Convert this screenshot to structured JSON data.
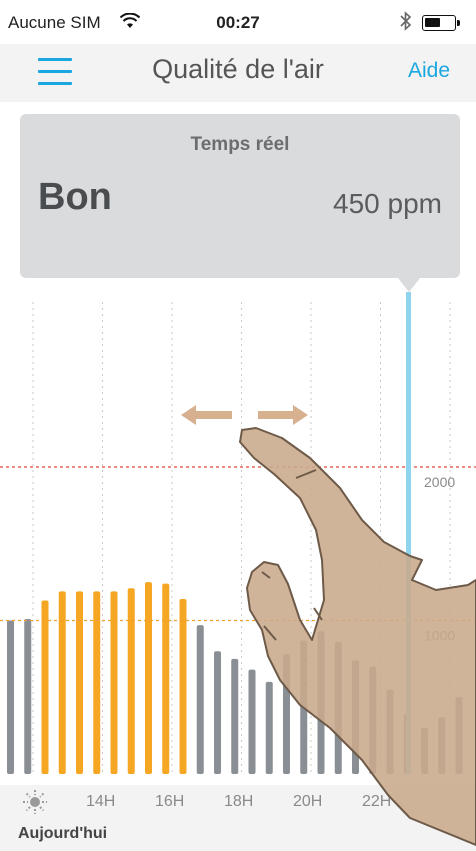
{
  "status_bar": {
    "carrier": "Aucune SIM",
    "wifi_icon": "wifi-icon",
    "time": "00:27",
    "bluetooth_icon": "bluetooth-icon",
    "battery_level": 0.55
  },
  "nav": {
    "menu_icon": "menu-icon",
    "title": "Qualité de l'air",
    "help": "Aide"
  },
  "realtime": {
    "label": "Temps réel",
    "status": "Bon",
    "value": "450 ppm"
  },
  "colors": {
    "accent": "#1aa7e0",
    "bar_gray": "#8a8f95",
    "bar_orange": "#f5a623",
    "threshold_red": "#e04a3a",
    "threshold_orange": "#f0a030",
    "cursor": "#8fd4ef"
  },
  "chart_data": {
    "type": "bar",
    "y_ticks": [
      {
        "value": 2000,
        "label": "2000"
      },
      {
        "value": 1000,
        "label": "1000"
      }
    ],
    "thresholds": [
      {
        "value": 2000,
        "color": "red"
      },
      {
        "value": 1000,
        "color": "orange"
      }
    ],
    "values": [
      1000,
      1010,
      1130,
      1190,
      1190,
      1190,
      1190,
      1210,
      1250,
      1240,
      1140,
      970,
      800,
      750,
      680,
      600,
      780,
      870,
      930,
      860,
      740,
      700,
      550,
      390,
      300,
      370,
      500
    ],
    "bar_colors": [
      "gray",
      "gray",
      "orange",
      "orange",
      "orange",
      "orange",
      "orange",
      "orange",
      "orange",
      "orange",
      "orange",
      "gray",
      "gray",
      "gray",
      "gray",
      "gray",
      "gray",
      "gray",
      "gray",
      "gray",
      "gray",
      "gray",
      "gray",
      "gray",
      "gray",
      "gray",
      "gray"
    ],
    "cursor_value": 450
  },
  "time_axis": {
    "sun_icon": "sun-icon",
    "ticks": [
      "14H",
      "16H",
      "18H",
      "20H",
      "22H"
    ],
    "day": "Aujourd'hui"
  },
  "gesture": {
    "arrows_icon": "swipe-arrows-icon",
    "hand_icon": "pointing-hand-icon"
  }
}
